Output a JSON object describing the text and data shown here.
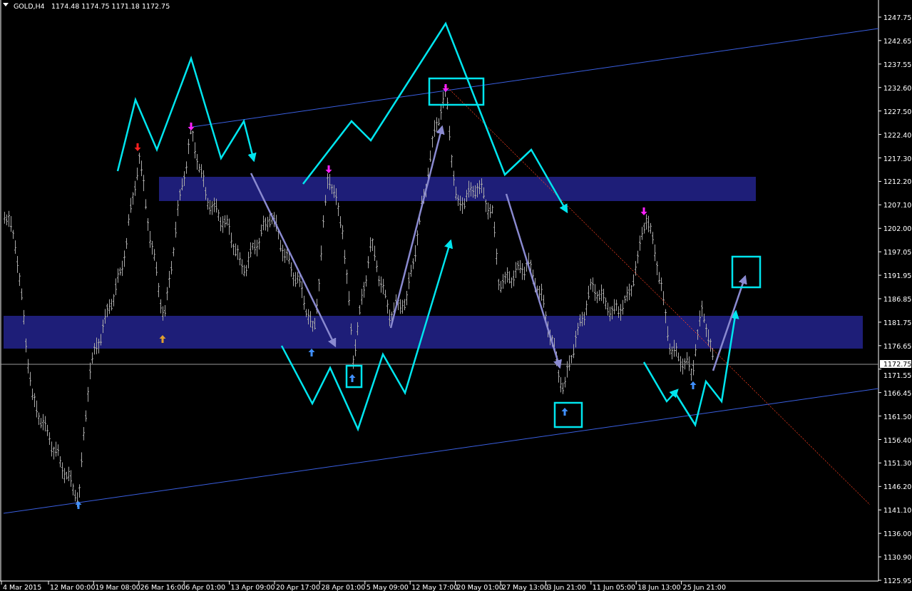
{
  "chart": {
    "symbol": "GOLD,H4",
    "quotes": [
      "1174.48",
      "1174.75",
      "1171.18",
      "1172.75"
    ],
    "price_labels": [
      "1247.75",
      "1242.65",
      "1237.55",
      "1232.60",
      "1227.50",
      "1222.40",
      "1217.30",
      "1212.20",
      "1207.10",
      "1202.00",
      "1197.05",
      "1191.95",
      "1186.85",
      "1181.75",
      "1176.65",
      "1171.55",
      "1166.45",
      "1161.50",
      "1156.40",
      "1151.30",
      "1146.20",
      "1141.10",
      "1136.00",
      "1130.90",
      "1125.95"
    ],
    "current_price": "1172.75",
    "time_labels": [
      "4 Mar 2015",
      "12 Mar 00:00",
      "19 Mar 08:00",
      "26 Mar 16:00",
      "6 Apr 01:00",
      "13 Apr 09:00",
      "20 Apr 17:00",
      "28 Apr 01:00",
      "5 May 09:00",
      "12 May 17:00",
      "20 May 01:00",
      "27 May 13:00",
      "3 Jun 21:00",
      "11 Jun 05:00",
      "18 Jun 13:00",
      "25 Jun 21:00"
    ]
  }
}
